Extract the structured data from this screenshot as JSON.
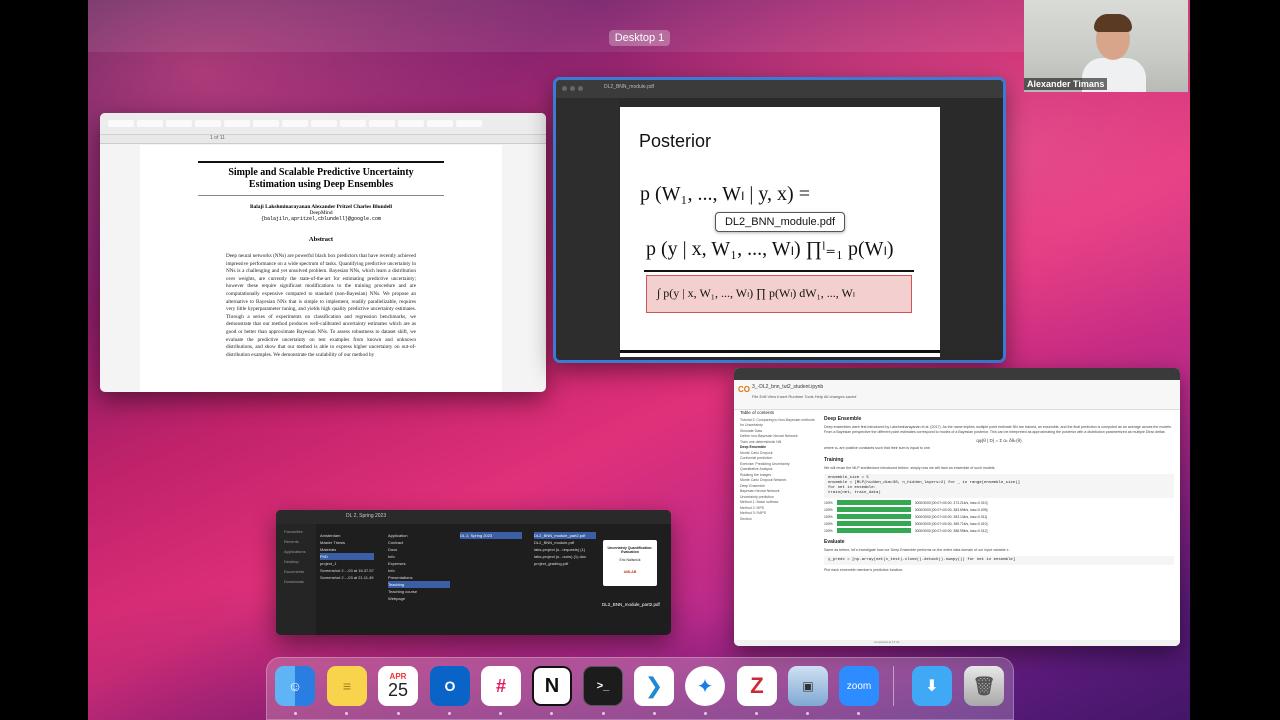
{
  "desktop": {
    "label": "Desktop 1"
  },
  "camera": {
    "participant_name": "Alexander Timans"
  },
  "paper_window": {
    "title_line1": "Simple and Scalable Predictive Uncertainty",
    "title_line2": "Estimation using Deep Ensembles",
    "authors": "Balaji Lakshminarayanan    Alexander Pritzel    Charles Blundell",
    "affiliation": "DeepMind",
    "email": "{balajiln,apritzel,cblundell}@google.com",
    "abstract_heading": "Abstract",
    "abstract_text": "Deep neural networks (NNs) are powerful black box predictors that have recently achieved impressive performance on a wide spectrum of tasks. Quantifying predictive uncertainty in NNs is a challenging and yet unsolved problem. Bayesian NNs, which learn a distribution over weights, are currently the state-of-the-art for estimating predictive uncertainty; however these require significant modifications to the training procedure and are computationally expensive compared to standard (non-Bayesian) NNs. We propose an alternative to Bayesian NNs that is simple to implement, readily parallelizable, requires very little hyperparameter tuning, and yields high quality predictive uncertainty estimates. Through a series of experiments on classification and regression benchmarks, we demonstrate that our method produces well-calibrated uncertainty estimates which are as good or better than approximate Bayesian NNs. To assess robustness to dataset shift, we evaluate the predictive uncertainty on test examples from known and unknown distributions, and show that our method is able to express higher uncertainty on out-of-distribution examples. We demonstrate the scalability of our method by",
    "page_indicator": "1 of 11"
  },
  "slide_window": {
    "file_title": "DL2_BNN_module.pdf",
    "slide_heading": "Posterior",
    "eq_line1": "p (W₁, ..., Wₗ | y, x) =",
    "eq_line2": "p (y | x, W₁, ..., Wₗ)  ∏ˡ₌₁ p(Wₗ)",
    "eq_denominator": "∫ p(y | x, W₁, ..., Wₗ) ∏ p(Wₗ) dW₁, ..., Wₗ",
    "tooltip": "DL2_BNN_module.pdf"
  },
  "finder_window": {
    "title": "DL 2, Spring 2023",
    "sidebar": [
      "Favourites",
      "Recents",
      "Applications",
      "Desktop",
      "Documents",
      "Downloads"
    ],
    "col1": [
      "Amsterdam",
      "Master Thesis",
      "Materials",
      "PhD",
      "project_1",
      "Screenshot 2...-03 at 16.37.57",
      "Screenshot 2...-03 at 21.11.49"
    ],
    "col2": [
      "Application",
      "Contract",
      "Docs",
      "Info",
      "Expenses",
      "Info",
      "Presentations",
      "Teaching",
      "Teaching course",
      "Webpage"
    ],
    "col3": [
      "DL 2, Spring 2023"
    ],
    "col4": [
      "DL2_BNN_module_part2.pdf",
      "DL2_BNN_module.pdf",
      "labs-project (s...requests) (1)",
      "labs-project (s...nuns) (1).doc",
      "project_grading.pdf"
    ],
    "preview_title": "Uncertainty Quantification: Evaluation",
    "preview_author": "Eric Nalisnick",
    "preview_org": "AMLAB",
    "preview_file": "DL2_BNN_module_part2.pdf"
  },
  "colab_window": {
    "logo": "CO",
    "notebook_title": "3_-DL2_bnn_tut2_student.ipynb",
    "menu": "File  Edit  View  Insert  Runtime  Tools  Help  All changes saved",
    "toc_heading": "Table of contents",
    "toc_items": [
      "Tutorial 2: Comparing to Non-Bayesian methods for Uncertainty",
      "Simulate Data",
      "Define non-Bayesian Neural Network",
      "Train one deterministic NN",
      "Deep Ensemble",
      "Monte Carlo Dropout",
      "Conformal prediction",
      "Exercise: Predicting Uncertainty",
      "Quantitative Analysis",
      "Rotating the images",
      "Monte Carlo Dropout Network",
      "Deep Ensemble",
      "Bayesian Neural Network",
      "Uncertainty prediction",
      "Method 1: Basic softmax",
      "Method 2: MPS",
      "Method 3: RAPS",
      "Section"
    ],
    "section_title": "Deep Ensemble",
    "section_text": "Deep ensembles were first introduced by Lakshminarayanan et al. (2017). As the name implies multiple point estimate NN are trained, an ensemble, and the final prediction is computed as an average across the models. From a Bayesian perspective the different point estimates correspond to modes of a Bayesian posterior. This can be interpreted as approximating the posterior with a distribution parametrized as multiple Dirac deltas",
    "formula": "qφ(θ | D) = Σ αₖ δθₖ(θ)",
    "where_text": "where αₖ are positive constants such that their sum is equal to one.",
    "training_title": "Training",
    "training_text": "We will reuse the MLP architecture introduced before, simply now we will train an ensemble of such models.",
    "code_lines": [
      "ensemble_size = 5",
      "ensemble = [MLP(hidden_dim=30, n_hidden_layers=2) for _ in range(ensemble_size)]",
      "for net in ensemble:",
      "    train(net, train_data)"
    ],
    "progress": [
      {
        "pct": "100%",
        "info": "3000/3000 [00:07<00:00, 373.21it/s, loss=0.010]"
      },
      {
        "pct": "100%",
        "info": "3000/3000 [00:07<00:00, 383.69it/s, loss=0.009]"
      },
      {
        "pct": "100%",
        "info": "3000/3000 [00:07<00:00, 383.14it/s, loss=0.011]"
      },
      {
        "pct": "100%",
        "info": "3000/3000 [00:07<00:00, 389.71it/s, loss=0.010]"
      },
      {
        "pct": "100%",
        "info": "3000/3000 [00:07<00:00, 388.95it/s, loss=0.012]"
      }
    ],
    "evaluate_title": "Evaluate",
    "evaluate_text": "Same as before, let's investigate how our Deep Ensemble performs on the entire data domain of our input variable x.",
    "code2": "y_preds = [np.array(net(x_test).clone().detach().numpy()) for net in ensemble]",
    "plot_text": "Plot each ensemble member's predictive function.",
    "footer": "completed at 17:21"
  },
  "dock": {
    "calendar_month": "APR",
    "calendar_day": "25",
    "apps": [
      "finder-icon",
      "notes-icon",
      "calendar-icon",
      "outlook-icon",
      "slack-icon",
      "notion-icon",
      "terminal-icon",
      "vscode-icon",
      "safari-icon",
      "zotero-icon",
      "preview-icon",
      "zoom-icon",
      "downloads-folder-icon",
      "trash-icon"
    ],
    "zoom_label": "zoom"
  }
}
